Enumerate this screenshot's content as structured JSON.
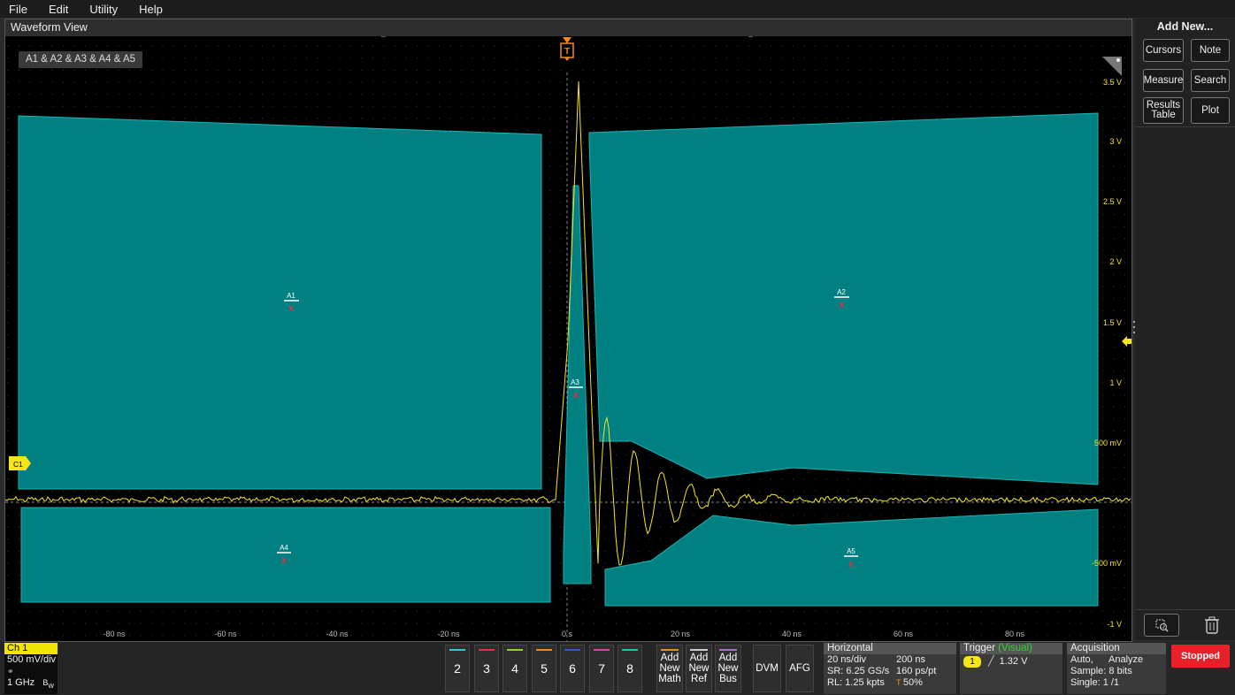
{
  "menu": [
    "File",
    "Edit",
    "Utility",
    "Help"
  ],
  "waveform_view": {
    "title": "Waveform View",
    "source_badge": "A1 & A2 & A3 & A4 & A5",
    "channel_marker": "C1",
    "trigger_marker": "T",
    "area_labels": [
      "A1",
      "A2",
      "A3",
      "A4",
      "A5"
    ],
    "y_axis_labels": [
      "3.5 V",
      "3 V",
      "2.5 V",
      "2 V",
      "1.5 V",
      "1 V",
      "500 mV",
      "-500 mV",
      "-1 V"
    ],
    "x_axis_labels": [
      "-80 ns",
      "-60 ns",
      "-40 ns",
      "-20 ns",
      "0 s",
      "20 ns",
      "40 ns",
      "60 ns",
      "80 ns"
    ],
    "colors": {
      "trace": "#f5e61c",
      "mask": "#008080",
      "mask_edge": "#19b5b5",
      "trigger": "#f08a1c"
    }
  },
  "sidebar": {
    "title": "Add New...",
    "buttons": [
      "Cursors",
      "Note",
      "Measure",
      "Search",
      "Results Table",
      "Plot"
    ],
    "bottom_icons": [
      "zoom-icon",
      "trash-icon"
    ]
  },
  "bottom": {
    "ch1": {
      "label": "Ch 1",
      "scale": "500 mV/div",
      "bandwidth": "1 GHz",
      "bw_flag": "B",
      "bw_flag_sub": "W"
    },
    "channels": [
      {
        "label": "2",
        "color": "#2ac9e0"
      },
      {
        "label": "3",
        "color": "#e0304a"
      },
      {
        "label": "4",
        "color": "#8fd12c"
      },
      {
        "label": "5",
        "color": "#f08a1c"
      },
      {
        "label": "6",
        "color": "#2e5ad8"
      },
      {
        "label": "7",
        "color": "#e040b0"
      },
      {
        "label": "8",
        "color": "#19c9a4"
      }
    ],
    "add": [
      {
        "l1": "Add",
        "l2": "New",
        "l3": "Math",
        "color": "#f08a1c"
      },
      {
        "l1": "Add",
        "l2": "New",
        "l3": "Ref",
        "color": "#cccccc"
      },
      {
        "l1": "Add",
        "l2": "New",
        "l3": "Bus",
        "color": "#b06ad8"
      }
    ],
    "dvm": "DVM",
    "afg": "AFG",
    "horizontal": {
      "title": "Horizontal",
      "scale": "20 ns/div",
      "position": "200 ns",
      "sr": "SR: 6.25 GS/s",
      "pt": "160 ps/pt",
      "rl": "RL: 1.25 kpts",
      "pct": "50%"
    },
    "trigger": {
      "title": "Trigger",
      "mode": "(Visual)",
      "source": "1",
      "level": "1.32 V"
    },
    "acquisition": {
      "title": "Acquisition",
      "mode": "Auto,",
      "analyze": "Analyze",
      "sample": "Sample: 8 bits",
      "single": "Single: 1 /1"
    },
    "stopped": "Stopped"
  }
}
